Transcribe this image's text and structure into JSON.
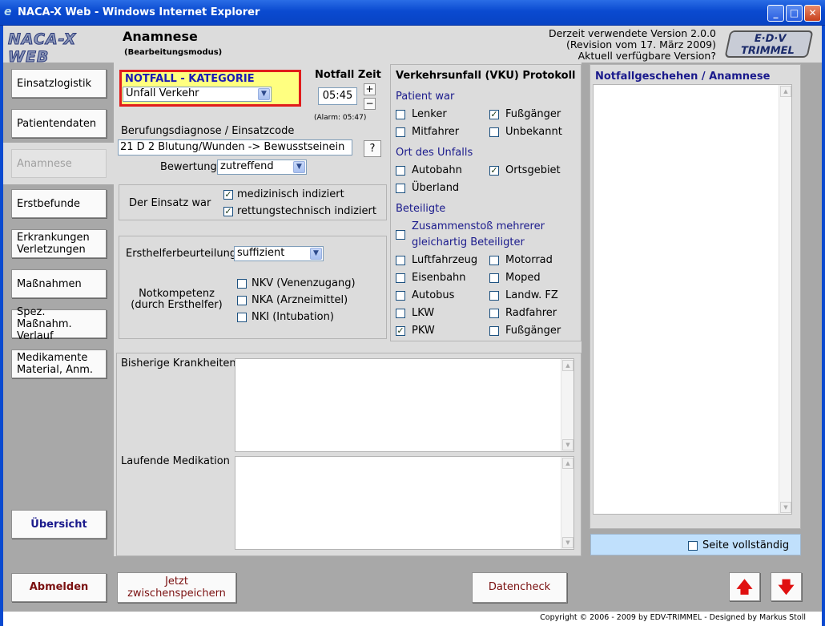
{
  "window": {
    "title": "NACA-X Web - Windows Internet Explorer",
    "icon": "ie-icon"
  },
  "header": {
    "logo": "NACA-X WEB",
    "page_title": "Anamnese",
    "page_subtitle": "(Bearbeitungsmodus)",
    "version_line1": "Derzeit verwendete Version 2.0.0",
    "version_line2": "(Revision vom 17. März 2009)",
    "version_line3": "Aktuell verfügbare Version?",
    "company_logo_line1": "E·D·V",
    "company_logo_line2": "TRIMMEL"
  },
  "sidebar": {
    "items": [
      {
        "label": "Einsatzlogistik",
        "active": false
      },
      {
        "label": "Patientendaten",
        "active": false
      },
      {
        "label": "Anamnese",
        "active": true
      },
      {
        "label": "Erstbefunde",
        "active": false
      },
      {
        "label": "Erkrankungen Verletzungen",
        "active": false
      },
      {
        "label": "Maßnahmen",
        "active": false
      },
      {
        "label": "Spez. Maßnahm. Verlauf",
        "active": false
      },
      {
        "label": "Medikamente Material, Anm.",
        "active": false
      }
    ],
    "overview_label": "Übersicht"
  },
  "notfall": {
    "category_label": "NOTFALL - KATEGORIE",
    "category_value": "Unfall Verkehr",
    "time_label": "Notfall Zeit",
    "time_value": "05:45",
    "plus": "+",
    "minus": "−",
    "alarm": "(Alarm: 05:47)"
  },
  "diagnose": {
    "label": "Berufungsdiagnose / Einsatzcode",
    "value": "21 D 2  Blutung/Wunden  -> Bewusstseinein",
    "help": "?",
    "bewertung_label": "Bewertung",
    "bewertung_value": "zutreffend"
  },
  "einsatz": {
    "label": "Der Einsatz war",
    "options": [
      {
        "label": "medizinisch indiziert",
        "checked": true
      },
      {
        "label": "rettungstechnisch indiziert",
        "checked": true
      }
    ]
  },
  "ersthelfer": {
    "label": "Ersthelferbeurteilung",
    "value": "suffizient",
    "notkompetenz_line1": "Notkompetenz",
    "notkompetenz_line2": "(durch Ersthelfer)",
    "options": [
      {
        "label": "NKV (Venenzugang)",
        "checked": false
      },
      {
        "label": "NKA (Arzneimittel)",
        "checked": false
      },
      {
        "label": "NKI (Intubation)",
        "checked": false
      }
    ]
  },
  "vku": {
    "title": "Verkehrsunfall (VKU) Protokoll",
    "patient_label": "Patient war",
    "patient": [
      {
        "label": "Lenker",
        "checked": false
      },
      {
        "label": "Fußgänger",
        "checked": true
      },
      {
        "label": "Mitfahrer",
        "checked": false
      },
      {
        "label": "Unbekannt",
        "checked": false
      }
    ],
    "ort_label": "Ort des Unfalls",
    "ort": [
      {
        "label": "Autobahn",
        "checked": false
      },
      {
        "label": "Ortsgebiet",
        "checked": true
      },
      {
        "label": "Überland",
        "checked": false
      }
    ],
    "beteiligte_label": "Beteiligte",
    "zusammenstoss_line1": "Zusammenstoß mehrerer",
    "zusammenstoss_line2": "gleichartig Beteiligter",
    "beteiligte": [
      {
        "label": "Luftfahrzeug",
        "checked": false
      },
      {
        "label": "Motorrad",
        "checked": false
      },
      {
        "label": "Eisenbahn",
        "checked": false
      },
      {
        "label": "Moped",
        "checked": false
      },
      {
        "label": "Autobus",
        "checked": false
      },
      {
        "label": "Landw. FZ",
        "checked": false
      },
      {
        "label": "LKW",
        "checked": false
      },
      {
        "label": "Radfahrer",
        "checked": false
      },
      {
        "label": "PKW",
        "checked": true
      },
      {
        "label": "Fußgänger",
        "checked": false
      }
    ]
  },
  "history": {
    "krankheiten_label": "Bisherige Krankheiten",
    "krankheiten_value": "",
    "medikation_label": "Laufende Medikation",
    "medikation_value": ""
  },
  "notfallgeschehen": {
    "title": "Notfallgeschehen / Anamnese",
    "value": ""
  },
  "seite_vollstaendig": {
    "label": "Seite vollständig",
    "checked": false
  },
  "bottom": {
    "logout": "Abmelden",
    "save_line1": "Jetzt",
    "save_line2": "zwischenspeichern",
    "datencheck": "Datencheck",
    "up_icon": "arrow-up-icon",
    "down_icon": "arrow-down-icon"
  },
  "footer": {
    "copyright": "Copyright © 2006 - 2009 by EDV-TRIMMEL - Designed by Markus Stoll"
  },
  "colors": {
    "accent_blue": "#1a1a8c",
    "highlight_red": "#e01c1c",
    "category_yellow": "#ffff80",
    "xp_titlebar": "#0a4ad0"
  }
}
